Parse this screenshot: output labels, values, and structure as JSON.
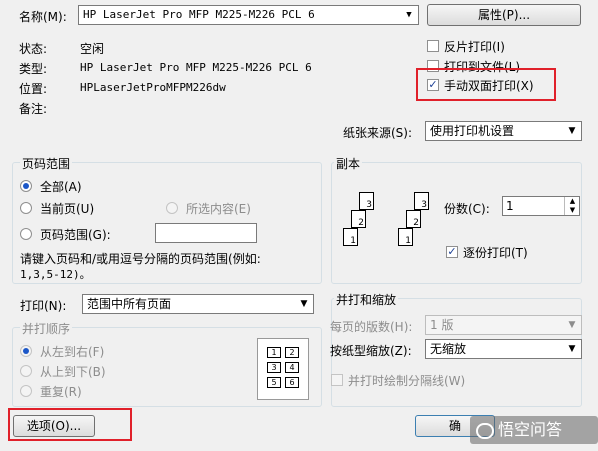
{
  "printer": {
    "name_label": "名称(M):",
    "name_value": "HP LaserJet Pro MFP M225-M226 PCL 6",
    "properties_btn": "属性(P)...",
    "status_label": "状态:",
    "status_value": "空闲",
    "type_label": "类型:",
    "type_value": "HP LaserJet Pro MFP M225-M226 PCL 6",
    "where_label": "位置:",
    "where_value": "HPLaserJetProMFPM226dw",
    "comment_label": "备注:"
  },
  "options": {
    "reverse_print": "反片打印(I)",
    "print_to_file": "打印到文件(L)",
    "manual_duplex": "手动双面打印(X)",
    "manual_duplex_checked": true,
    "paper_source_label": "纸张来源(S):",
    "paper_source_value": "使用打印机设置"
  },
  "page_range": {
    "legend": "页码范围",
    "all": "全部(A)",
    "current": "当前页(U)",
    "selection": "所选内容(E)",
    "pages": "页码范围(G):",
    "pages_value": "",
    "hint": "请键入页码和/或用逗号分隔的页码范围(例如:",
    "hint_example": "1,3,5-12)。"
  },
  "copies": {
    "legend": "副本",
    "count_label": "份数(C):",
    "count_value": "1",
    "collate": "逐份打印(T)",
    "collate_checked": true
  },
  "print_what": {
    "label": "打印(N):",
    "value": "范围中所有页面"
  },
  "print_order": {
    "legend": "并打顺序",
    "left_to_right": "从左到右(F)",
    "top_to_bottom": "从上到下(B)",
    "repeat": "重复(R)",
    "grid": [
      "1",
      "2",
      "3",
      "4",
      "5",
      "6"
    ]
  },
  "zoom": {
    "legend": "并打和缩放",
    "pages_per_sheet_label": "每页的版数(H):",
    "pages_per_sheet_value": "1 版",
    "scale_label": "按纸型缩放(Z):",
    "scale_value": "无缩放",
    "draw_borders": "并打时绘制分隔线(W)"
  },
  "footer": {
    "options_btn": "选项(O)...",
    "ok_btn": "确",
    "watermark": "悟空问答"
  },
  "colors": {
    "highlight": "#e0202a"
  }
}
